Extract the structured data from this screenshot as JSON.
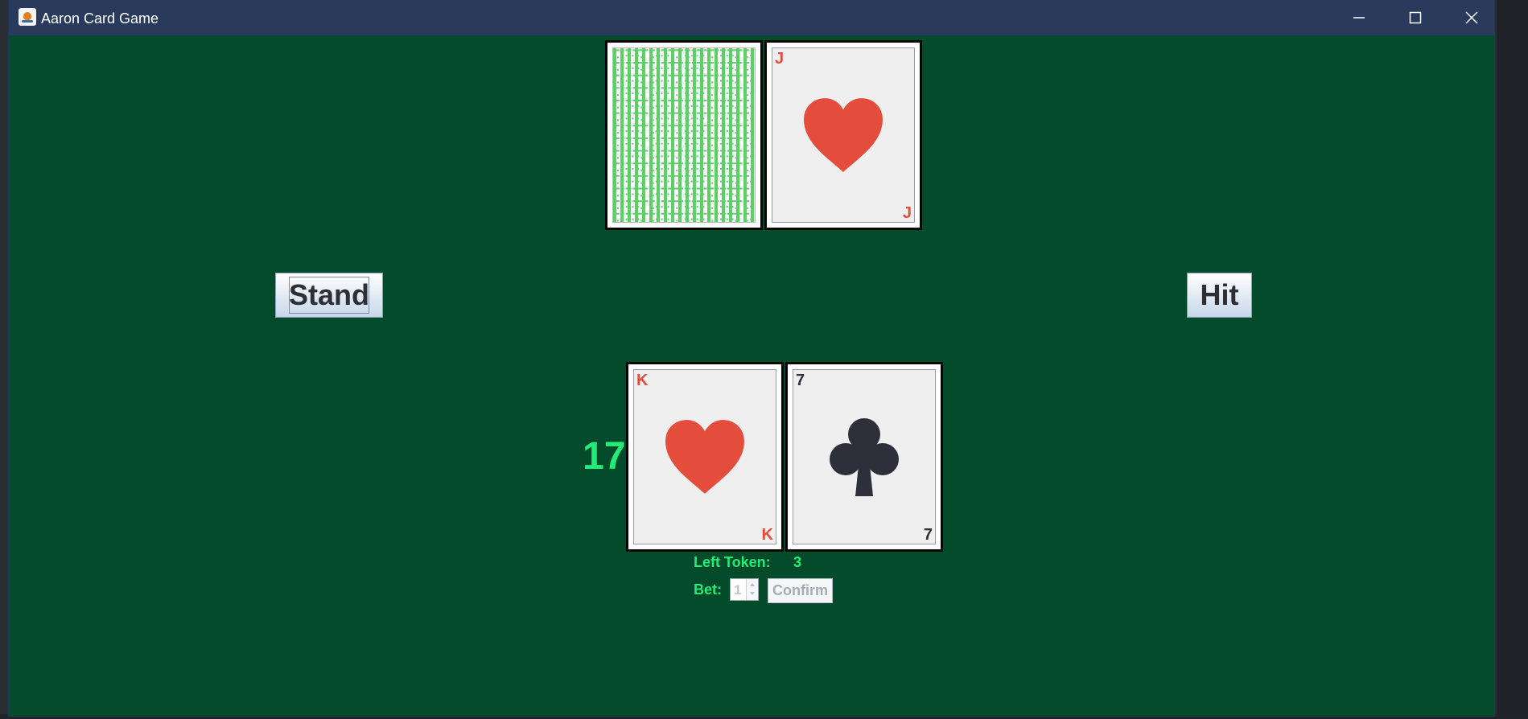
{
  "window": {
    "title": "Aaron Card Game",
    "controls": [
      "minimize-icon",
      "maximize-icon",
      "close-icon"
    ]
  },
  "dealer": {
    "cards": [
      {
        "face_down": true
      },
      {
        "rank": "J",
        "suit": "hearts",
        "suit_icon": "heart-icon",
        "color": "#e44d3c"
      }
    ]
  },
  "player": {
    "score": "17",
    "cards": [
      {
        "rank": "K",
        "suit": "hearts",
        "suit_icon": "heart-icon",
        "color": "#e44d3c"
      },
      {
        "rank": "7",
        "suit": "clubs",
        "suit_icon": "club-icon",
        "color": "#2e2f3a"
      }
    ]
  },
  "actions": {
    "stand_label": "Stand",
    "hit_label": "Hit"
  },
  "betting": {
    "tokens_label": "Left Token:",
    "tokens_value": "3",
    "bet_label": "Bet:",
    "bet_value": "1",
    "confirm_label": "Confirm"
  },
  "colors": {
    "table": "#034b2a",
    "titlebar": "#2a3a5d",
    "score_text": "#22ec78",
    "red_suit": "#e44d3c",
    "black_suit": "#2e2f3a"
  }
}
